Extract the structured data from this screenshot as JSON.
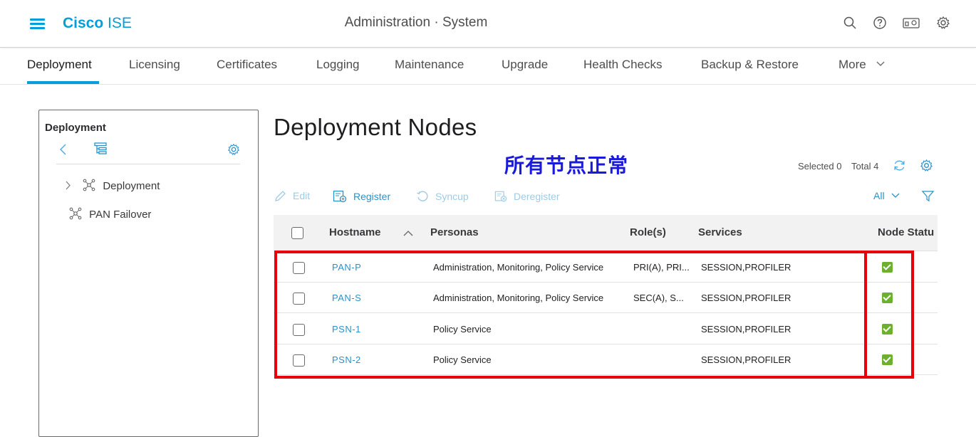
{
  "header": {
    "brand_bold": "Cisco",
    "brand_light": "ISE",
    "title": "Administration · System",
    "icons": [
      "search-icon",
      "help-icon",
      "dashboard-icon",
      "settings-icon"
    ]
  },
  "tabs": [
    {
      "label": "Deployment",
      "active": true
    },
    {
      "label": "Licensing"
    },
    {
      "label": "Certificates"
    },
    {
      "label": "Logging"
    },
    {
      "label": "Maintenance"
    },
    {
      "label": "Upgrade"
    },
    {
      "label": "Health Checks"
    },
    {
      "label": "Backup & Restore"
    },
    {
      "label": "More"
    }
  ],
  "sidebar": {
    "title": "Deployment",
    "items": [
      {
        "label": "Deployment"
      },
      {
        "label": "PAN Failover"
      }
    ]
  },
  "main": {
    "title": "Deployment Nodes",
    "annotation": "所有节点正常",
    "selected_label": "Selected 0",
    "total_label": "Total 4",
    "actions": {
      "edit": "Edit",
      "register": "Register",
      "syncup": "Syncup",
      "deregister": "Deregister",
      "filter_select": "All"
    }
  },
  "table": {
    "headers": {
      "hostname": "Hostname",
      "personas": "Personas",
      "roles": "Role(s)",
      "services": "Services",
      "node_status": "Node Statu"
    },
    "rows": [
      {
        "hostname": "PAN-P",
        "personas": "Administration, Monitoring, Policy Service",
        "roles": "PRI(A), PRI...",
        "services": "SESSION,PROFILER",
        "status": "ok"
      },
      {
        "hostname": "PAN-S",
        "personas": "Administration, Monitoring, Policy Service",
        "roles": "SEC(A), S...",
        "services": "SESSION,PROFILER",
        "status": "ok"
      },
      {
        "hostname": "PSN-1",
        "personas": "Policy Service",
        "roles": "",
        "services": "SESSION,PROFILER",
        "status": "ok"
      },
      {
        "hostname": "PSN-2",
        "personas": "Policy Service",
        "roles": "",
        "services": "SESSION,PROFILER",
        "status": "ok"
      }
    ]
  },
  "colors": {
    "accent": "#049fd9",
    "link": "#2b92c9",
    "status_ok": "#6cb02d",
    "highlight": "#e8000b",
    "annotation": "#1a1adb"
  }
}
